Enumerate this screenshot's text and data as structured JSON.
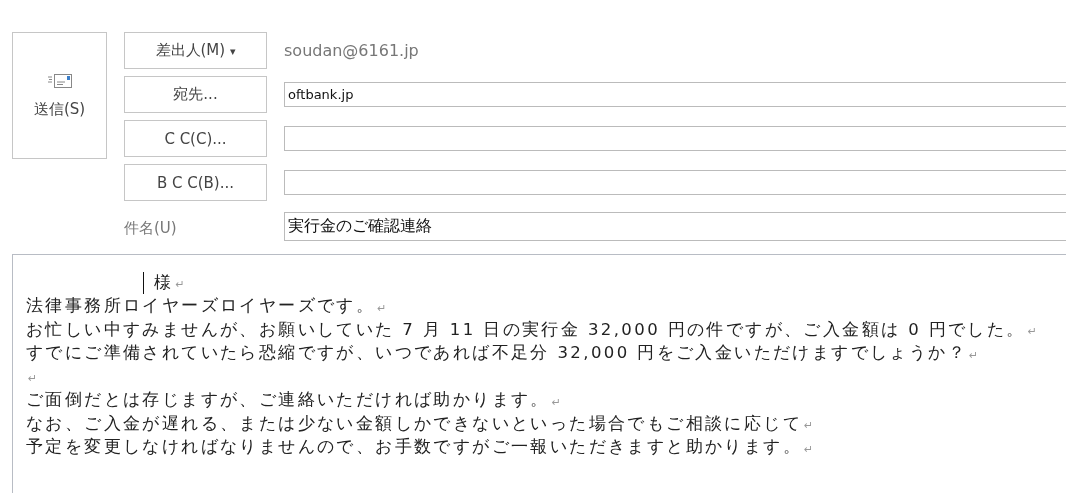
{
  "send_button": {
    "label": "送信(S)"
  },
  "header_fields": [
    {
      "kind": "from",
      "button": "差出人(M)",
      "caret": "▾",
      "value": "soudan@6161.jp"
    },
    {
      "kind": "field",
      "button": "宛先...",
      "value": "oftbank.jp"
    },
    {
      "kind": "field",
      "button": "C C(C)..."
    },
    {
      "kind": "field",
      "button": "B C C(B)..."
    },
    {
      "kind": "subject",
      "label": "件名(U)",
      "value": "実行金のご確認連絡"
    }
  ],
  "body": {
    "lines": [
      {
        "text": "様",
        "cursor": true,
        "mark": "↵"
      },
      {
        "text": "法律事務所ロイヤーズロイヤーズです。",
        "cursor": false,
        "mark": "↵"
      },
      {
        "text": "お忙しい中すみませんが、お願いしていた 7 月 11 日の実行金 32,000 円の件ですが、ご入金額は 0 円でした。",
        "cursor": false,
        "mark": "↵"
      },
      {
        "text": "すでにご準備されていたら恐縮ですが、いつであれば不足分 32,000 円をご入金いただけますでしょうか？",
        "cursor": false,
        "mark": "↵"
      },
      {
        "cursor": false,
        "mark": "↵"
      },
      {
        "text": "ご面倒だとは存じますが、ご連絡いただければ助かります。",
        "cursor": false,
        "mark": "↵"
      },
      {
        "text": "なお、ご入金が遅れる、または少ない金額しかできないといった場合でもご相談に応じて",
        "cursor": false,
        "mark": "↵"
      },
      {
        "text": "予定を変更しなければなりませんので、お手数ですがご一報いただきますと助かります。",
        "cursor": false,
        "mark": "↵"
      }
    ]
  }
}
